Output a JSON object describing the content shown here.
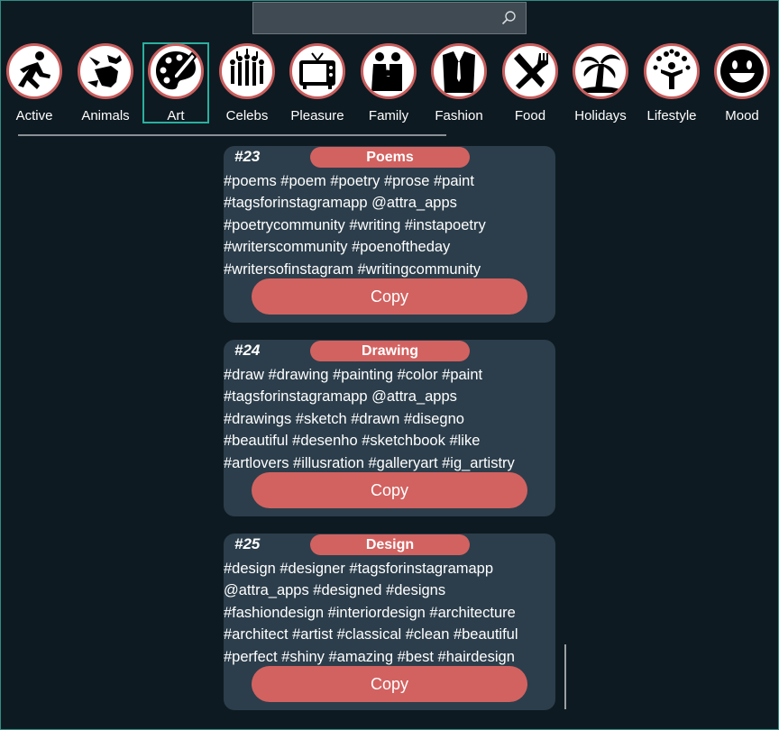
{
  "search": {
    "placeholder": "",
    "icon": "search-icon"
  },
  "categories": [
    {
      "label": "Active",
      "icon": "running-person-icon"
    },
    {
      "label": "Animals",
      "icon": "animals-icon"
    },
    {
      "label": "Art",
      "icon": "palette-icon",
      "selected": true
    },
    {
      "label": "Celebs",
      "icon": "crowd-icon"
    },
    {
      "label": "Pleasure",
      "icon": "tv-icon"
    },
    {
      "label": "Family",
      "icon": "family-icon"
    },
    {
      "label": "Fashion",
      "icon": "suit-icon"
    },
    {
      "label": "Food",
      "icon": "cutlery-icon"
    },
    {
      "label": "Holidays",
      "icon": "palm-tree-icon"
    },
    {
      "label": "Lifestyle",
      "icon": "tree-person-icon"
    },
    {
      "label": "Mood",
      "icon": "smiley-icon"
    }
  ],
  "cards": [
    {
      "number": "#23",
      "title": "Poems",
      "tags": " #poems #poem #poetry #prose #paint\n#tagsforinstagramapp @attra_apps\n#poetrycommunity #writing #instapoetry\n#writerscommunity #poenoftheday\n#writersofinstagram #writingcommunity",
      "copy_label": "Copy"
    },
    {
      "number": "#24",
      "title": "Drawing",
      "tags": "#draw #drawing #painting #color #paint\n#tagsforinstagramapp @attra_apps\n#drawings #sketch #drawn #disegno\n#beautiful #desenho #sketchbook #like\n#artlovers #illusration #galleryart #ig_artistry",
      "copy_label": "Copy"
    },
    {
      "number": "#25",
      "title": "Design",
      "tags": "#design #designer #tagsforinstagramapp\n@attra_apps #designed #designs\n#fashiondesign #interiordesign #architecture\n#architect #artist #classical #clean #beautiful\n#perfect #shiny #amazing #best #hairdesign",
      "copy_label": "Copy"
    }
  ],
  "colors": {
    "background": "#0e1a21",
    "card": "#2c3e4b",
    "accent": "#d26260",
    "selection": "#2ab0a0"
  }
}
